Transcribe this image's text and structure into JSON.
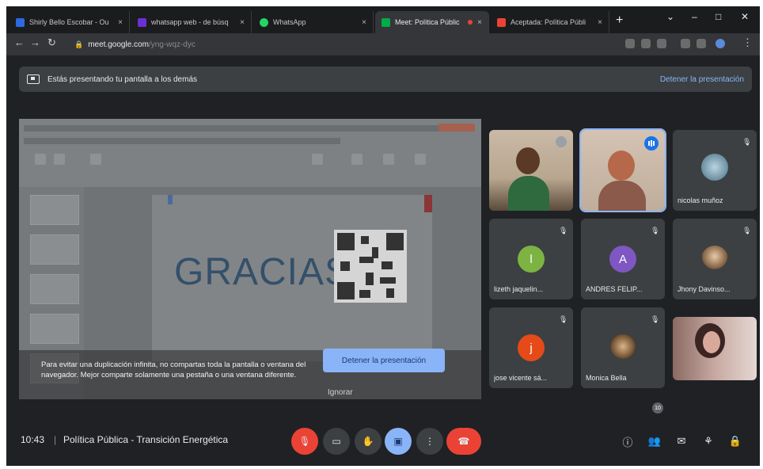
{
  "browser": {
    "tabs": [
      {
        "label": "Shirly Bello Escobar - Ou",
        "icon": "outlook-icon",
        "color": "#2b6ae0"
      },
      {
        "label": "whatsapp web - de búsq",
        "icon": "yahoo-icon",
        "color": "#6b2fd3"
      },
      {
        "label": "WhatsApp",
        "icon": "whatsapp-icon",
        "color": "#25d366"
      },
      {
        "label": "Meet: Política Públic",
        "icon": "meet-icon",
        "color": "#00ac47",
        "active": true
      },
      {
        "label": "Aceptada: Política Públi",
        "icon": "gmail-icon",
        "color": "#ea4335"
      }
    ],
    "tab_close": "×",
    "new_tab": "+",
    "url": {
      "host": "meet.google.com",
      "path": "/yng-wqz-dyc"
    }
  },
  "banner": {
    "text": "Estás presentando tu pantalla a los demás",
    "stop_link": "Detener la presentación"
  },
  "shared_screen": {
    "slide_title": "GRACIAS",
    "duplication_warning": "Para evitar una duplicación infinita, no compartas toda la pantalla o ventana del navegador. Mejor comparte solamente una pestaña o una ventana diferente.",
    "stop_button": "Detener la presentación",
    "ignore_button": "Ignorar"
  },
  "participants": [
    {
      "name": "",
      "type": "video",
      "muted": true
    },
    {
      "name": "",
      "type": "video",
      "speaking": true
    },
    {
      "name": "nicolas muñoz",
      "type": "avatar-image",
      "muted": true
    },
    {
      "name": "lizeth jaquelin...",
      "type": "initial",
      "initial": "l",
      "color": "#7cb342",
      "muted": true
    },
    {
      "name": "ANDRES FELIP...",
      "type": "initial",
      "initial": "A",
      "color": "#7e57c2",
      "muted": true
    },
    {
      "name": "Jhony Davinso...",
      "type": "avatar-image",
      "muted": true
    },
    {
      "name": "jose vicente sá...",
      "type": "initial",
      "initial": "j",
      "color": "#e64a19",
      "muted": true
    },
    {
      "name": "Monica Bella",
      "type": "avatar-image",
      "muted": true
    },
    {
      "name": "",
      "type": "video"
    }
  ],
  "meeting": {
    "time": "10:43",
    "separator": "|",
    "title": "Política Pública - Transición Energética",
    "people_count": "10"
  },
  "colors": {
    "background": "#202124",
    "tile": "#3c4043",
    "accent_blue": "#8ab4f8",
    "danger_red": "#ea4335"
  }
}
